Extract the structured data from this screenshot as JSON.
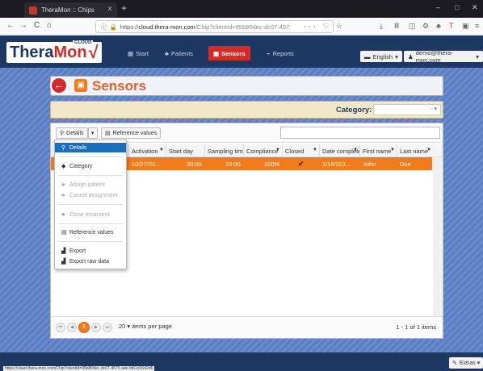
{
  "browser": {
    "tab_title": "TheraMon :: Chips",
    "tab_close": "×",
    "new_tab": "+",
    "win_min": "–",
    "win_max": "□",
    "win_close": "✕",
    "back": "←",
    "forward": "→",
    "reload": "C",
    "home": "⌂",
    "url_info": "ⓘ",
    "url_lock": "🔒",
    "url_scheme": "https://",
    "url_host": "cloud.thera-mon.com",
    "url_path": "/Chip?clientId=95b80dec-dc07-457",
    "url_more": "··· ♡ ☆",
    "status_url": "https://cloud.thera-mon.com/Chip?clientId=95b80dec-dc07-4579-ade-fd61d16d2d6"
  },
  "app": {
    "logo_text": "Thera",
    "logo_text2": "Mon",
    "logo_cloud": "CLOUD",
    "nav": [
      {
        "icon": "▦",
        "label": "Start"
      },
      {
        "icon": "♣",
        "label": "Patients"
      },
      {
        "icon": "▣",
        "label": "Sensors"
      },
      {
        "icon": "⌁",
        "label": "Reports"
      }
    ],
    "language": "English",
    "user": "demo@thera-mon.com",
    "page_title": "Sensors",
    "back_icon": "←",
    "sensor_icon": "▣",
    "category_label": "Category:",
    "category_value": "-",
    "footer_extras": "Extras"
  },
  "toolbar": {
    "details_label": "Details",
    "ref_values_label": "Reference values"
  },
  "table": {
    "columns": [
      {
        "label": "Activation"
      },
      {
        "label": "Start day"
      },
      {
        "label": "Sampling time"
      },
      {
        "label": "Compliance"
      },
      {
        "label": "Closed"
      },
      {
        "label": "Date complete"
      },
      {
        "label": "First name"
      },
      {
        "label": "Last name"
      }
    ],
    "row": {
      "activation": "10/27/20...",
      "start_day": "00:00",
      "sampling": "15:00",
      "compliance": "100%",
      "closed": "✔",
      "date_complete": "1/18/201...",
      "first_name": "John",
      "last_name": "Doe"
    }
  },
  "menu": {
    "details": "Details",
    "category": "Category",
    "assign_patient": "Assign patient",
    "cancel_assignment": "Cancel assignment",
    "close_treatment": "Close treatment",
    "reference_values": "Reference values",
    "export": "Export",
    "export_raw": "Export raw data"
  },
  "pager": {
    "first": "⏮",
    "prev": "◀",
    "current_page": "1",
    "next": "▶",
    "last": "⏭",
    "page_size": "20",
    "per_page_label": "items per page",
    "info": "1 - 1 of 1 items"
  },
  "colors": {
    "header_bg": "#1e3864",
    "accent_red": "#d62a2a",
    "accent_orange": "#f07c1e",
    "menu_selected": "#1b6fb8"
  }
}
